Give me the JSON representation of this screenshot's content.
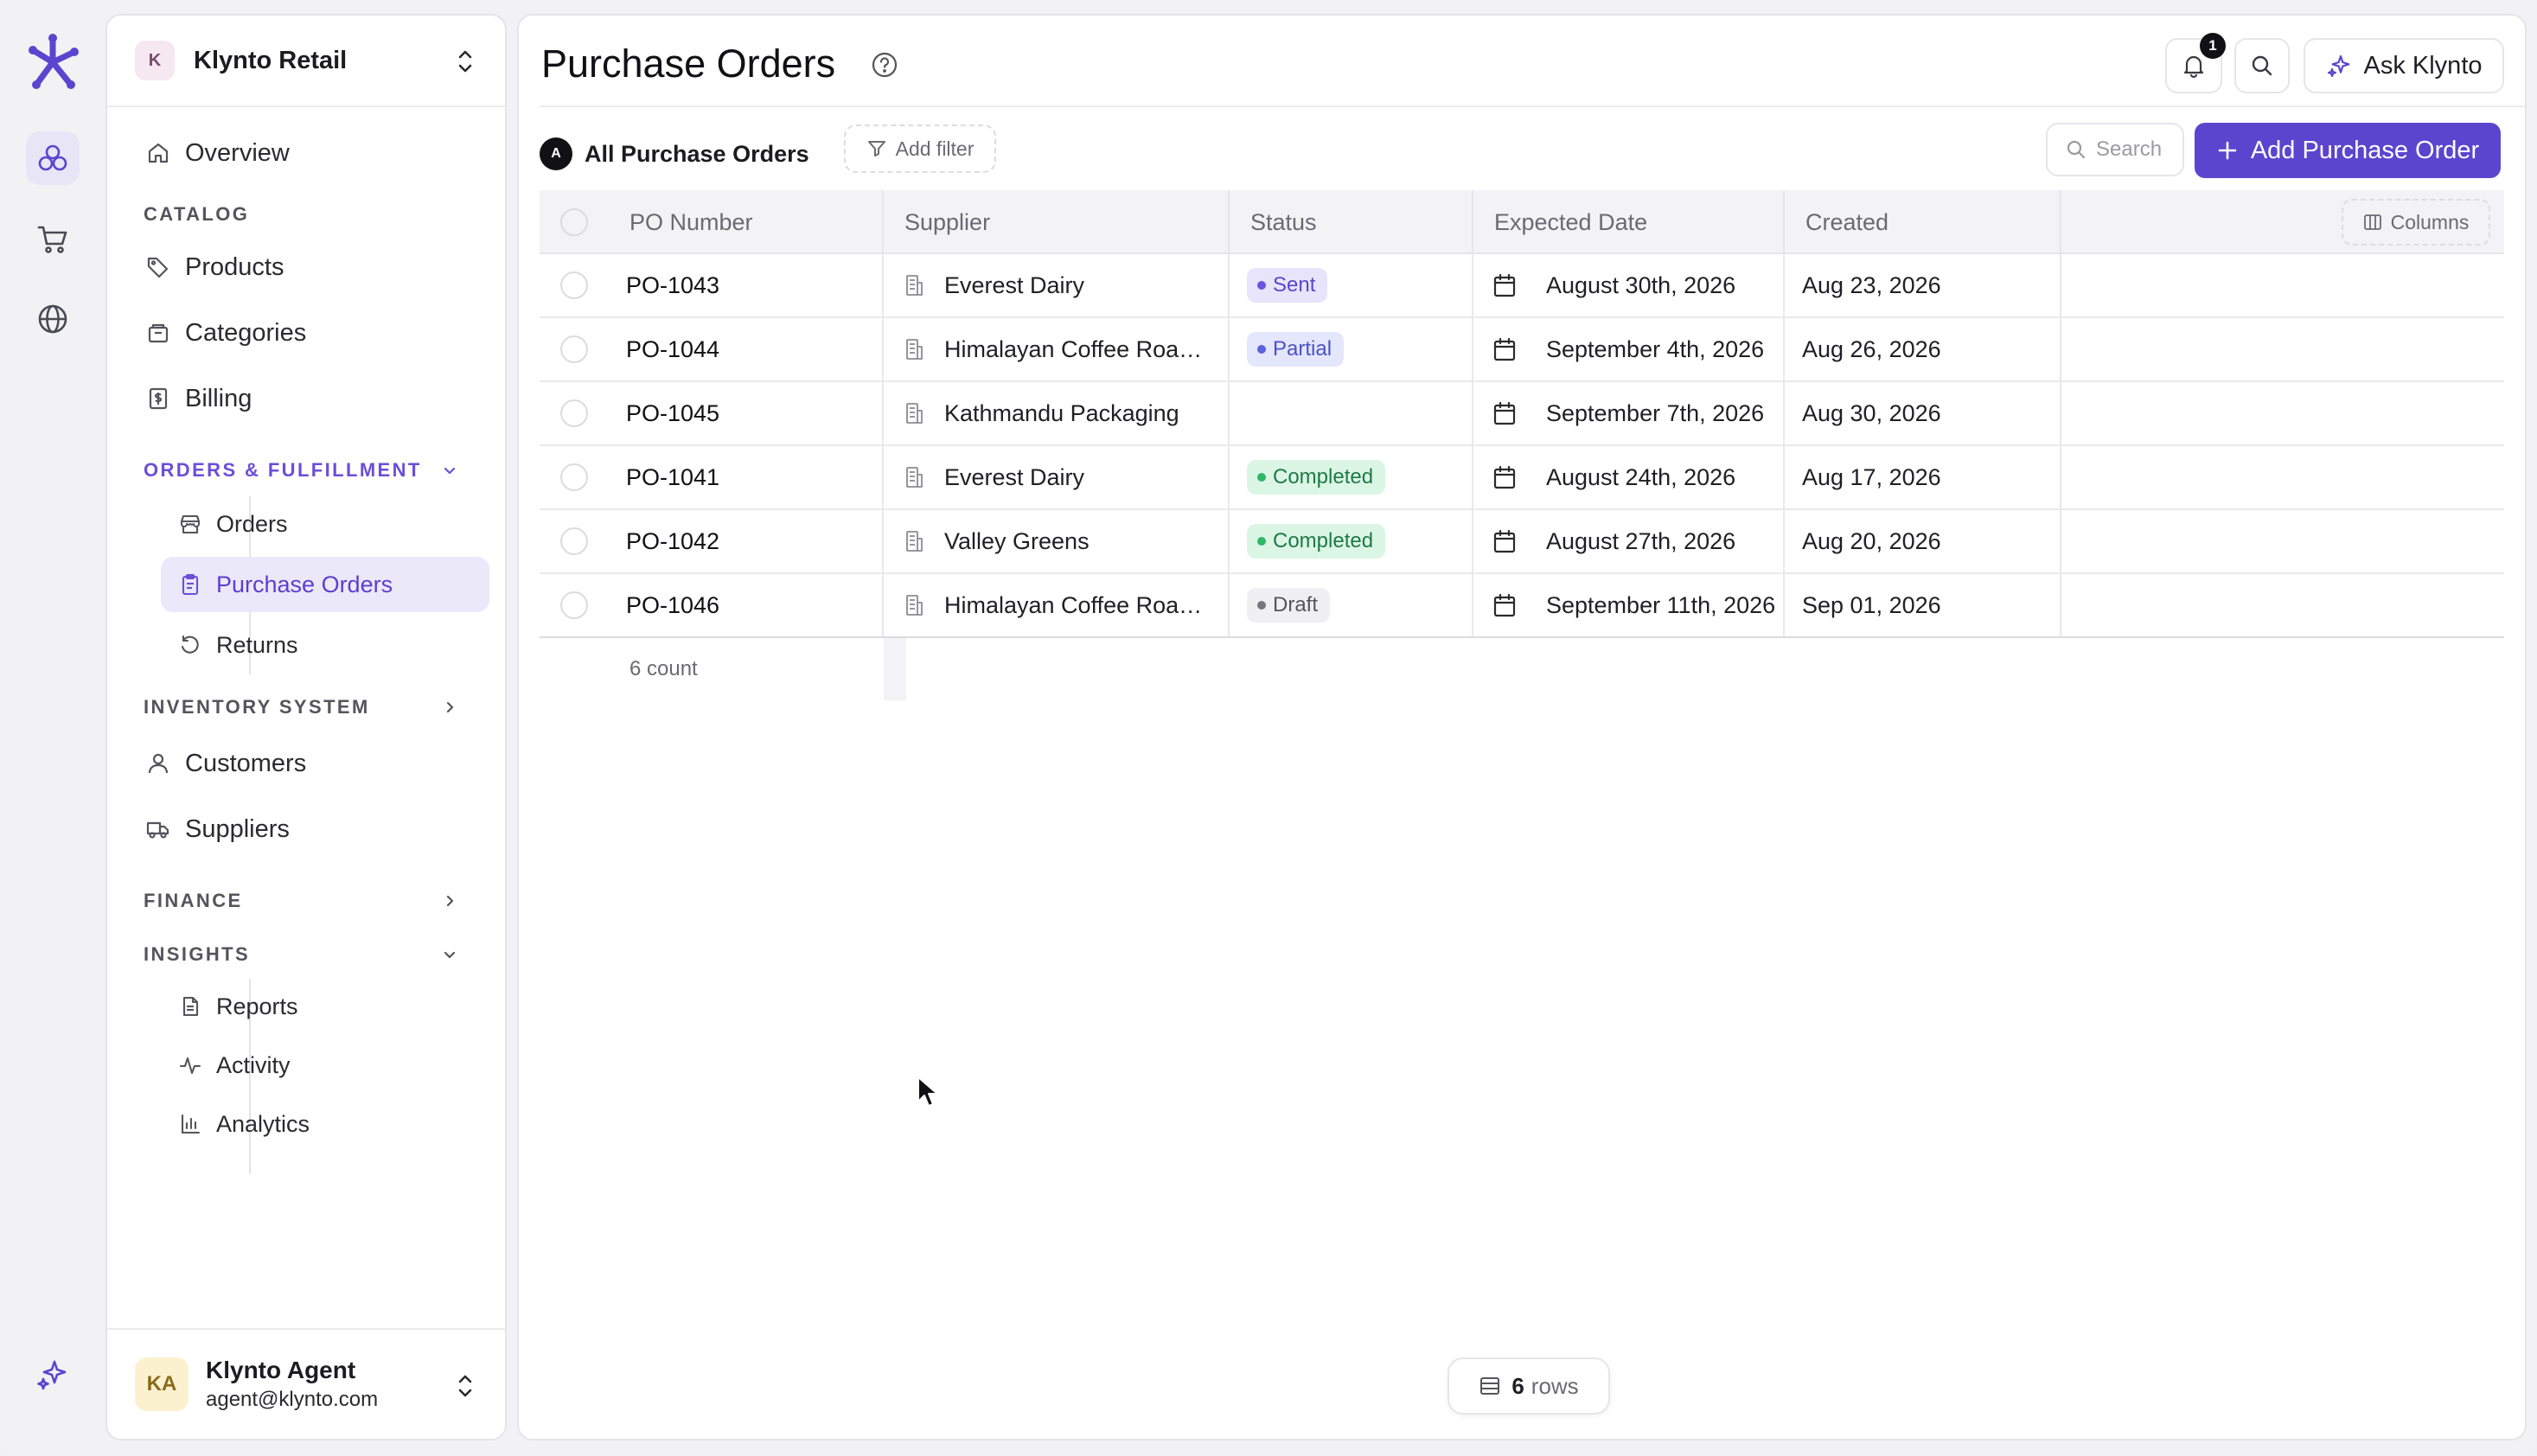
{
  "workspace": {
    "initial": "K",
    "name": "Klynto Retail"
  },
  "sidebar": {
    "overview": "Overview",
    "catalog_section": "CATALOG",
    "catalog_items": [
      "Products",
      "Categories",
      "Billing"
    ],
    "orders_section": "ORDERS & FULFILLMENT",
    "orders_items": [
      "Orders",
      "Purchase Orders",
      "Returns"
    ],
    "inventory_section": "INVENTORY SYSTEM",
    "people_items": [
      "Customers",
      "Suppliers"
    ],
    "finance_section": "FINANCE",
    "insights_section": "INSIGHTS",
    "insights_items": [
      "Reports",
      "Activity",
      "Analytics"
    ],
    "active_item": "Purchase Orders"
  },
  "user": {
    "initials": "KA",
    "name": "Klynto Agent",
    "email": "agent@klynto.com"
  },
  "header": {
    "title": "Purchase Orders",
    "notification_count": "1",
    "ask_label": "Ask Klynto"
  },
  "toolbar": {
    "view_initial": "A",
    "view_label": "All Purchase Orders",
    "filter_label": "Add filter",
    "search_placeholder": "Search",
    "add_label": "Add Purchase Order"
  },
  "table": {
    "columns": [
      "PO Number",
      "Supplier",
      "Status",
      "Expected Date",
      "Created"
    ],
    "columns_button": "Columns",
    "rows": [
      {
        "po": "PO-1043",
        "supplier": "Everest Dairy",
        "status": "Sent",
        "expected": "August 30th, 2026",
        "created": "Aug 23, 2026"
      },
      {
        "po": "PO-1044",
        "supplier": "Himalayan Coffee Roas...",
        "status": "Partial",
        "expected": "September 4th, 2026",
        "created": "Aug 26, 2026"
      },
      {
        "po": "PO-1045",
        "supplier": "Kathmandu Packaging",
        "status": "",
        "expected": "September 7th, 2026",
        "created": "Aug 30, 2026"
      },
      {
        "po": "PO-1041",
        "supplier": "Everest Dairy",
        "status": "Completed",
        "expected": "August 24th, 2026",
        "created": "Aug 17, 2026"
      },
      {
        "po": "PO-1042",
        "supplier": "Valley Greens",
        "status": "Completed",
        "expected": "August 27th, 2026",
        "created": "Aug 20, 2026"
      },
      {
        "po": "PO-1046",
        "supplier": "Himalayan Coffee Roas...",
        "status": "Draft",
        "expected": "September 11th, 2026",
        "created": "Sep 01, 2026"
      }
    ],
    "count_label": "6 count"
  },
  "status_colors": {
    "Sent": {
      "bg": "#e7e4fb",
      "fg": "#5b45cf",
      "dot": "#6a55e0"
    },
    "Partial": {
      "bg": "#e4e6fb",
      "fg": "#4b52c8",
      "dot": "#5a62dc"
    },
    "Completed": {
      "bg": "#dcf6e6",
      "fg": "#1f7a45",
      "dot": "#2fb866"
    },
    "Draft": {
      "bg": "#f0eff2",
      "fg": "#55545c",
      "dot": "#77767e"
    }
  },
  "footer": {
    "rows_count": "6",
    "rows_label": "rows"
  },
  "accent_color": "#5b45cf"
}
